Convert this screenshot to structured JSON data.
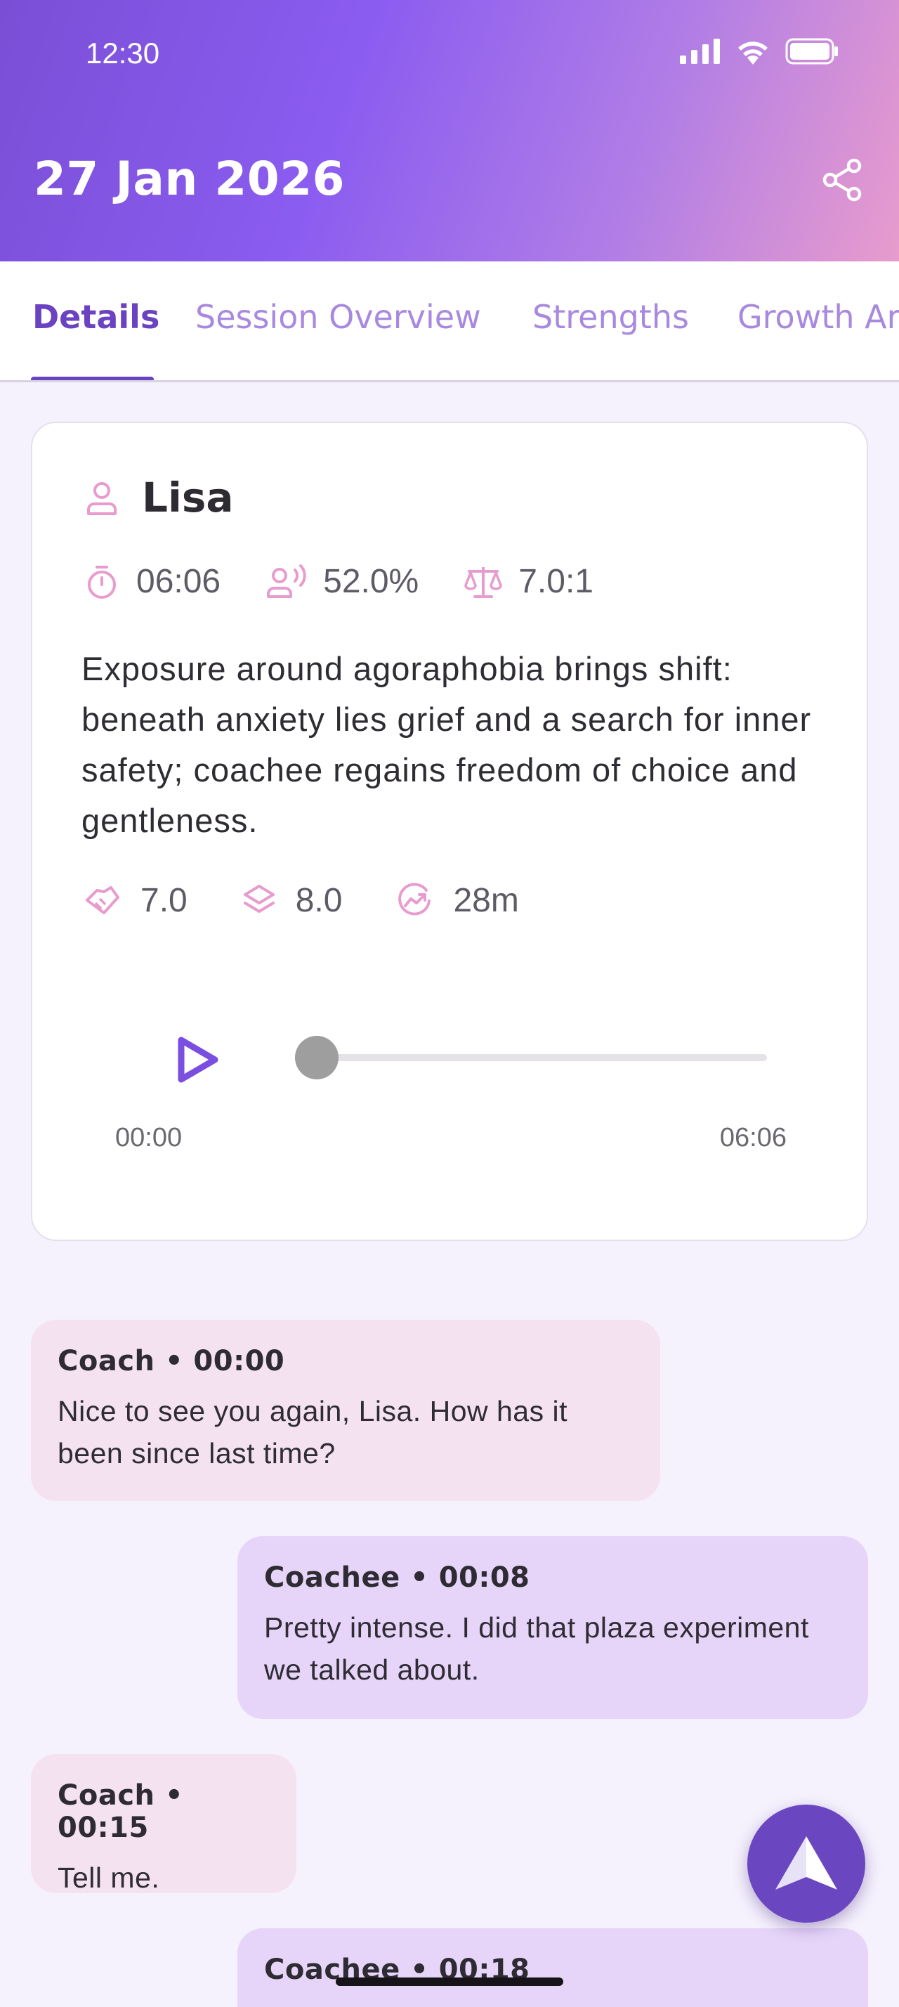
{
  "status_bar": {
    "time": "12:30"
  },
  "header": {
    "title": "27 Jan 2026"
  },
  "tabs": [
    {
      "label": "Details",
      "active": true
    },
    {
      "label": "Session Overview",
      "active": false
    },
    {
      "label": "Strengths",
      "active": false
    },
    {
      "label": "Growth Areas",
      "active": false
    }
  ],
  "session": {
    "name": "Lisa",
    "duration": "06:06",
    "talk_ratio": "52.0%",
    "balance": "7.0:1",
    "summary": "Exposure around agoraphobia brings shift: beneath anxiety lies grief and a search for inner safety; coachee regains freedom of choice and gentleness.",
    "rapport": "7.0",
    "depth": "8.0",
    "progress": "28m"
  },
  "player": {
    "current_time": "00:00",
    "total_time": "06:06",
    "position_fraction": 0.0
  },
  "messages": [
    {
      "role": "coach",
      "meta": "Coach • 00:00",
      "text": "Nice to see you again, Lisa. How has it been since last time?"
    },
    {
      "role": "coachee",
      "meta": "Coachee • 00:08",
      "text": "Pretty intense. I did that plaza experiment we talked about."
    },
    {
      "role": "coach",
      "meta": "Coach • 00:15",
      "text": "Tell me."
    },
    {
      "role": "coachee",
      "meta": "Coachee • 00:18",
      "text": ""
    }
  ],
  "colors": {
    "accent": "#6a42c2",
    "icon_pink": "#e89ccd",
    "coach_bubble": "#f4e2f1",
    "coachee_bubble": "#e6d5f8"
  }
}
